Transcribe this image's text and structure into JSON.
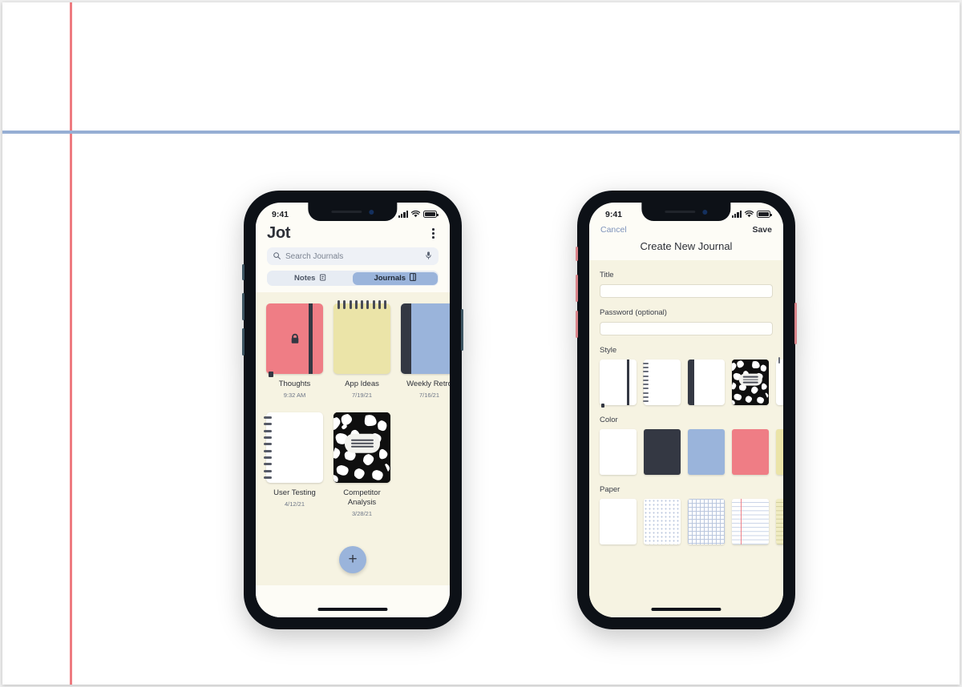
{
  "canvas": {
    "background": "#ffffff",
    "margin_rule_color": "#ee7b80",
    "header_rule_color": "#96aed4"
  },
  "phone_journals": {
    "frame_color": "#0d1117",
    "side_button_color": "#3c5562",
    "status_bar": {
      "time": "9:41",
      "signal_icon": "cellular-bars-icon",
      "wifi_icon": "wifi-icon",
      "battery_icon": "battery-icon"
    },
    "header": {
      "app_title": "Jot",
      "menu_icon": "kebab-menu-icon"
    },
    "search": {
      "icon": "search-icon",
      "placeholder": "Search Journals",
      "mic_icon": "microphone-icon"
    },
    "segmented_control": {
      "selected": "Journals",
      "options": [
        {
          "label": "Notes",
          "icon": "notes-icon",
          "active": false
        },
        {
          "label": "Journals",
          "icon": "journal-icon",
          "active": true
        }
      ]
    },
    "grid_background": "#f6f3e2",
    "journals": [
      {
        "name": "Thoughts",
        "date": "9:32 AM",
        "style": "hardcover-strap",
        "color": "#ef7d85",
        "locked": true,
        "lock_icon": "lock-icon"
      },
      {
        "name": "App Ideas",
        "date": "7/19/21",
        "style": "top-spiral",
        "color": "#ebe4a8",
        "locked": false
      },
      {
        "name": "Weekly Retro",
        "date": "7/16/21",
        "style": "spine-left",
        "color": "#9ab4db",
        "locked": false
      },
      {
        "name": "User Testing",
        "date": "4/12/21",
        "style": "side-spiral",
        "color": "#ffffff",
        "locked": false
      },
      {
        "name": "Competitor Analysis",
        "date": "3/28/21",
        "style": "marble-composition",
        "color": "#111111",
        "locked": false
      }
    ],
    "add_button": {
      "icon": "plus-icon",
      "label": "+",
      "color": "#9ab4db"
    }
  },
  "phone_create": {
    "frame_color": "#0d1117",
    "side_button_color": "#d9848a",
    "status_bar": {
      "time": "9:41",
      "signal_icon": "cellular-bars-icon",
      "wifi_icon": "wifi-icon",
      "battery_icon": "battery-icon"
    },
    "nav": {
      "cancel_label": "Cancel",
      "save_label": "Save",
      "title": "Create New Journal"
    },
    "fields": {
      "title_label": "Title",
      "title_value": "",
      "password_label": "Password (optional)",
      "password_value": ""
    },
    "style_section": {
      "label": "Style",
      "options": [
        {
          "name": "hardcover-strap",
          "selected": false
        },
        {
          "name": "side-spiral",
          "selected": false
        },
        {
          "name": "spine-left",
          "selected": false
        },
        {
          "name": "marble-composition",
          "selected": true
        },
        {
          "name": "top-spiral",
          "selected": false
        }
      ]
    },
    "color_section": {
      "label": "Color",
      "options": [
        {
          "name": "white",
          "hex": "#ffffff",
          "selected": false
        },
        {
          "name": "charcoal",
          "hex": "#343843",
          "selected": false
        },
        {
          "name": "blue",
          "hex": "#9ab4db",
          "selected": false
        },
        {
          "name": "coral",
          "hex": "#ef7d85",
          "selected": false
        },
        {
          "name": "cream",
          "hex": "#ebe4a8",
          "selected": false
        }
      ]
    },
    "paper_section": {
      "label": "Paper",
      "options": [
        {
          "name": "blank",
          "selected": false
        },
        {
          "name": "dotted",
          "selected": false
        },
        {
          "name": "graph",
          "selected": false
        },
        {
          "name": "ruled",
          "selected": false
        },
        {
          "name": "legal",
          "selected": false
        }
      ]
    }
  }
}
